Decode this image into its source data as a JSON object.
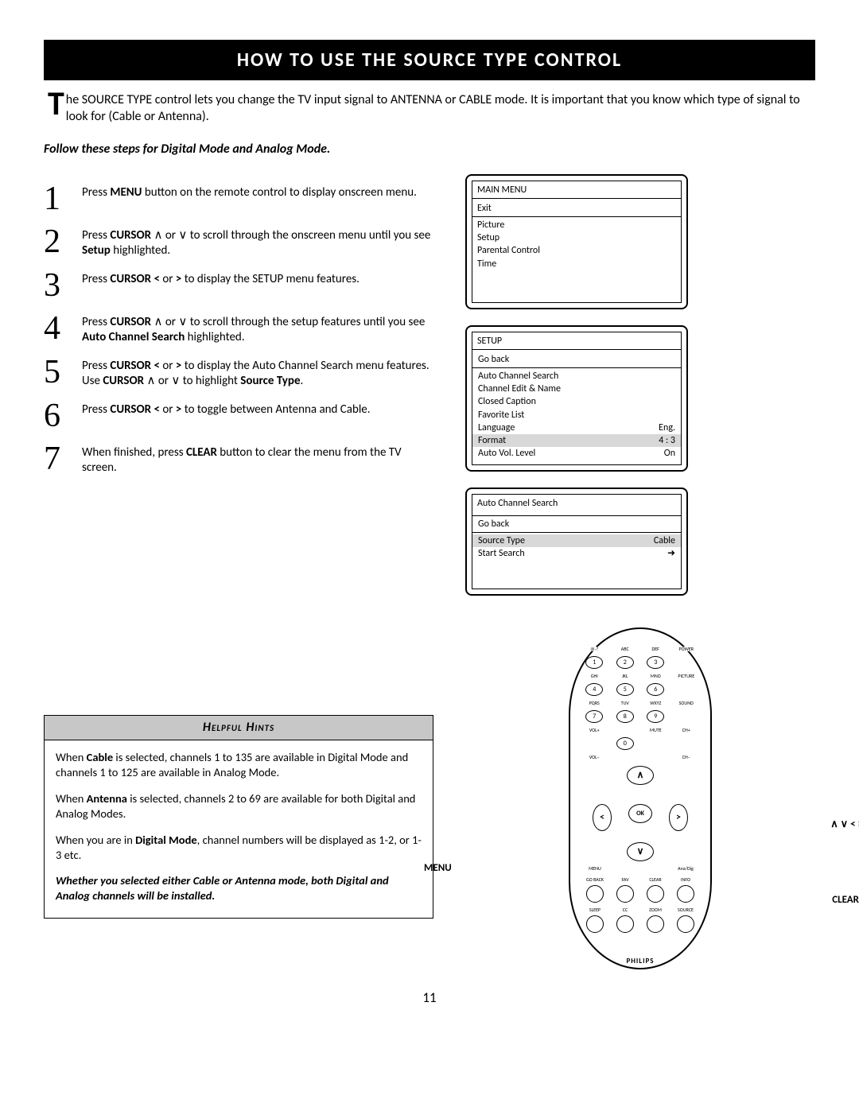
{
  "banner": "HOW TO USE THE SOURCE TYPE CONTROL",
  "intro": {
    "dropcap": "T",
    "text": "he SOURCE TYPE control lets you change the TV input signal to ANTENNA or CABLE mode. It is important that you know which type of signal to look for (Cable or Antenna)."
  },
  "subhead": "Follow these steps for Digital Mode and Analog Mode.",
  "steps": [
    {
      "n": "1",
      "pre": "Press ",
      "b1": "MENU",
      "t1": " button on the remote control to display onscreen menu."
    },
    {
      "n": "2",
      "pre": "Press ",
      "b1": "CURSOR",
      "t1": " ∧ or ∨ to scroll through the onscreen menu until you see ",
      "b2": "Setup",
      "t2": " highlighted."
    },
    {
      "n": "3",
      "pre": "Press ",
      "b1": "CURSOR <",
      "t1": " or ",
      "b2": ">",
      "t2": " to display the SETUP menu features."
    },
    {
      "n": "4",
      "pre": "Press ",
      "b1": "CURSOR",
      "t1": " ∧ or ∨ to scroll through the setup features until you see ",
      "b2": "Auto Channel Search",
      "t2": " highlighted."
    },
    {
      "n": "5",
      "pre": "Press ",
      "b1": "CURSOR <",
      "t1": " or ",
      "b2": ">",
      "t2": " to display the Auto Channel Search menu features. Use ",
      "b3": "CURSOR",
      "t3": "  ∧  or ∨ to highlight ",
      "b4": "Source Type",
      "t4": "."
    },
    {
      "n": "6",
      "pre": "Press ",
      "b1": "CURSOR <",
      "t1": " or ",
      "b2": ">",
      "t2": " to toggle between Antenna and Cable."
    },
    {
      "n": "7",
      "pre": "When finished, press ",
      "b1": "CLEAR",
      "t1": " button to clear the menu from the TV screen."
    }
  ],
  "menus": {
    "main": {
      "title": "MAIN MENU",
      "items": [
        "Exit",
        "Picture",
        "Setup",
        "Parental Control",
        "Time"
      ]
    },
    "setup": {
      "title": "SETUP",
      "items": [
        {
          "l": "Go back"
        },
        {
          "l": "Auto Channel Search"
        },
        {
          "l": "Channel Edit & Name"
        },
        {
          "l": "Closed Caption"
        },
        {
          "l": "Favorite List"
        },
        {
          "l": "Language",
          "r": "Eng."
        },
        {
          "l": "Format",
          "r": "4 : 3",
          "sel": true
        },
        {
          "l": "Auto Vol. Level",
          "r": "On"
        }
      ]
    },
    "acs": {
      "title": "Auto Channel Search",
      "items": [
        {
          "l": "Go back"
        },
        {
          "l": "Source Type",
          "r": "Cable",
          "sel": true
        },
        {
          "l": "Start Search",
          "arrow": true
        }
      ]
    }
  },
  "hints": {
    "title": "Helpful Hints",
    "p1a": "When ",
    "p1b": "Cable",
    "p1c": " is selected, channels 1 to 135 are available in Digital Mode and channels 1 to 125 are available in Analog Mode.",
    "p2a": "When ",
    "p2b": "Antenna",
    "p2c": " is selected, channels 2 to 69 are available for both Digital and Analog Modes.",
    "p3a": "When you are in ",
    "p3b": "Digital Mode",
    "p3c": ", channel numbers will be displayed as 1-2, or 1-3 etc.",
    "p4": "Whether you selected either Cable or Antenna mode, both Digital and Analog channels will be installed."
  },
  "remote": {
    "row_labels": [
      [
        "@-?",
        "ABC",
        "DEF",
        "POWER"
      ],
      [
        "1",
        "2",
        "3",
        ""
      ],
      [
        "GHI",
        "JKL",
        "MNO",
        "PICTURE"
      ],
      [
        "4",
        "5",
        "6",
        ""
      ],
      [
        "PQRS",
        "TUV",
        "WXYZ",
        "SOUND"
      ],
      [
        "7",
        "8",
        "9",
        ""
      ],
      [
        "VOL+",
        "",
        "MUTE",
        "CH+"
      ],
      [
        "",
        "0",
        "",
        ""
      ],
      [
        "VOL−",
        "",
        "",
        "CH−"
      ]
    ],
    "ok": "OK",
    "under_nav_l": "MENU",
    "under_nav_r": "Ana/Dig",
    "row_bottom1": [
      "GO BACK",
      "FAV",
      "CLEAR",
      "INFO"
    ],
    "row_bottom2": [
      "SLEEP",
      "CC",
      "ZOOM",
      "SOURCE"
    ],
    "brand": "PHILIPS"
  },
  "callouts": {
    "cursor": "∧  ∨  <  >",
    "menu": "MENU",
    "clear": "CLEAR"
  },
  "page": "11"
}
